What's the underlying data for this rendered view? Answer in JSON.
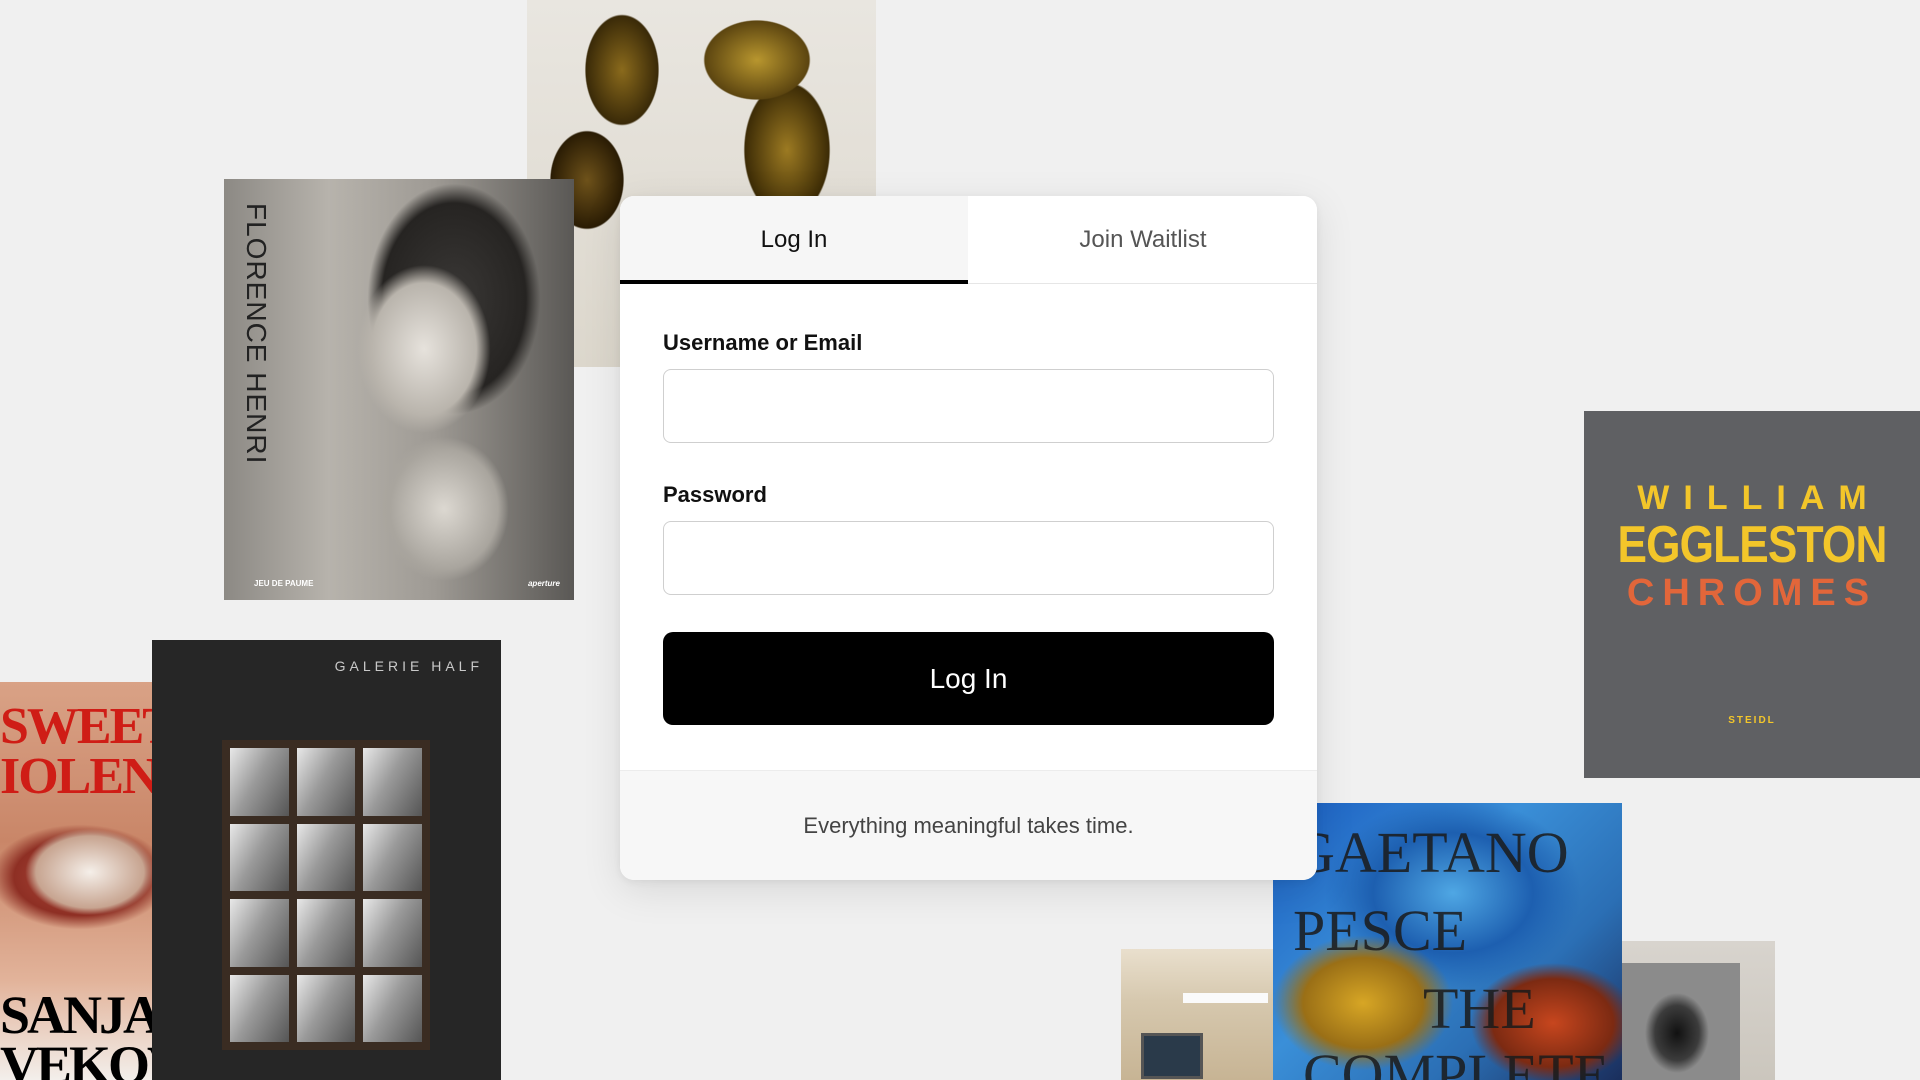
{
  "background_color": "#f0f0f0",
  "books": {
    "florence_henri": {
      "title": "FLORENCE HENRI",
      "publisher_left": "JEU DE PAUME",
      "publisher_right": "aperture"
    },
    "sweet_violence": {
      "title_lines": "SWEET\nIOLENCE",
      "author_lines": "SANJA\nVEKOVIĆ"
    },
    "galerie_half": {
      "label": "GALERIE HALF"
    },
    "eggleston": {
      "line1": "WILLIAM",
      "line2": "EGGLESTON",
      "line3": "CHROMES",
      "publisher": "STEIDL",
      "colors": {
        "background": "#5f6063",
        "yellow": "#f3c62a",
        "orange": "#e2663a"
      }
    },
    "gaetano_pesce": {
      "line1": "GAETANO",
      "line2": "PESCE",
      "line3": "THE",
      "line4": "COMPLETE"
    }
  },
  "login_card": {
    "tabs": [
      {
        "label": "Log In",
        "active": true
      },
      {
        "label": "Join Waitlist",
        "active": false
      }
    ],
    "username": {
      "label": "Username or Email",
      "value": "",
      "placeholder": ""
    },
    "password": {
      "label": "Password",
      "value": "",
      "placeholder": ""
    },
    "submit_label": "Log In",
    "footer_text": "Everything meaningful takes time.",
    "colors": {
      "primary_button": "#000000",
      "active_tab_indicator": "#000000"
    }
  }
}
